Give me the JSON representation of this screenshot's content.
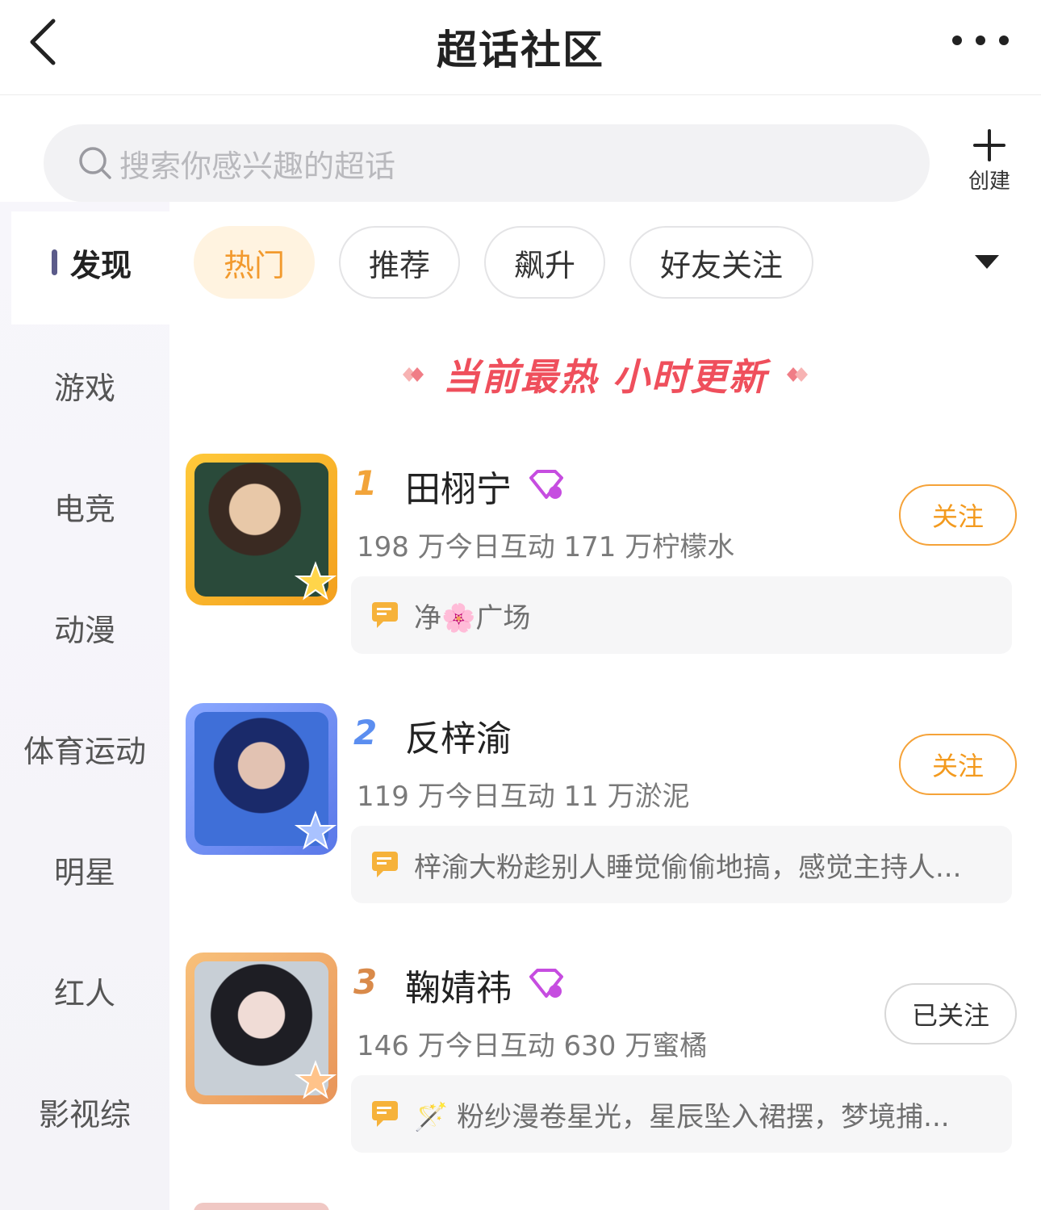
{
  "header": {
    "title": "超话社区"
  },
  "search": {
    "placeholder": "搜索你感兴趣的超话",
    "create_label": "创建"
  },
  "sidebar": {
    "active": "发现",
    "items": [
      "游戏",
      "电竞",
      "动漫",
      "体育运动",
      "明星",
      "红人",
      "影视综"
    ]
  },
  "tabs": [
    "热门",
    "推荐",
    "飙升",
    "好友关注"
  ],
  "banner": {
    "text": "当前最热 小时更新"
  },
  "ranking": [
    {
      "rank": "1",
      "name": "田栩宁",
      "stats": "198 万今日互动 171 万柠檬水",
      "follow": "关注",
      "post": "净🌸广场",
      "has_badge": true
    },
    {
      "rank": "2",
      "name": "反梓渝",
      "stats": "119 万今日互动 11 万淤泥",
      "follow": "关注",
      "post": "梓渝大粉趁别人睡觉偷偷地搞，感觉主持人...",
      "has_badge": false
    },
    {
      "rank": "3",
      "name": "鞠婧祎",
      "stats": "146 万今日互动 630 万蜜橘",
      "follow": "已关注",
      "post": "🪄 粉纱漫卷星光，星辰坠入裙摆，梦境捕...",
      "has_badge": true
    }
  ],
  "colors": {
    "accent": "#f39a1e",
    "banner": "#ef4f5c",
    "rank1": "#f2a43a",
    "rank2": "#5b8ef0",
    "rank3": "#d98a4a"
  },
  "icons": {
    "back": "chevron-left-icon",
    "more": "more-dots-icon",
    "search": "search-icon",
    "create": "plus-icon",
    "dropdown": "caret-down-icon",
    "post": "chat-bubble-icon",
    "badge": "diamond-badge-icon"
  }
}
